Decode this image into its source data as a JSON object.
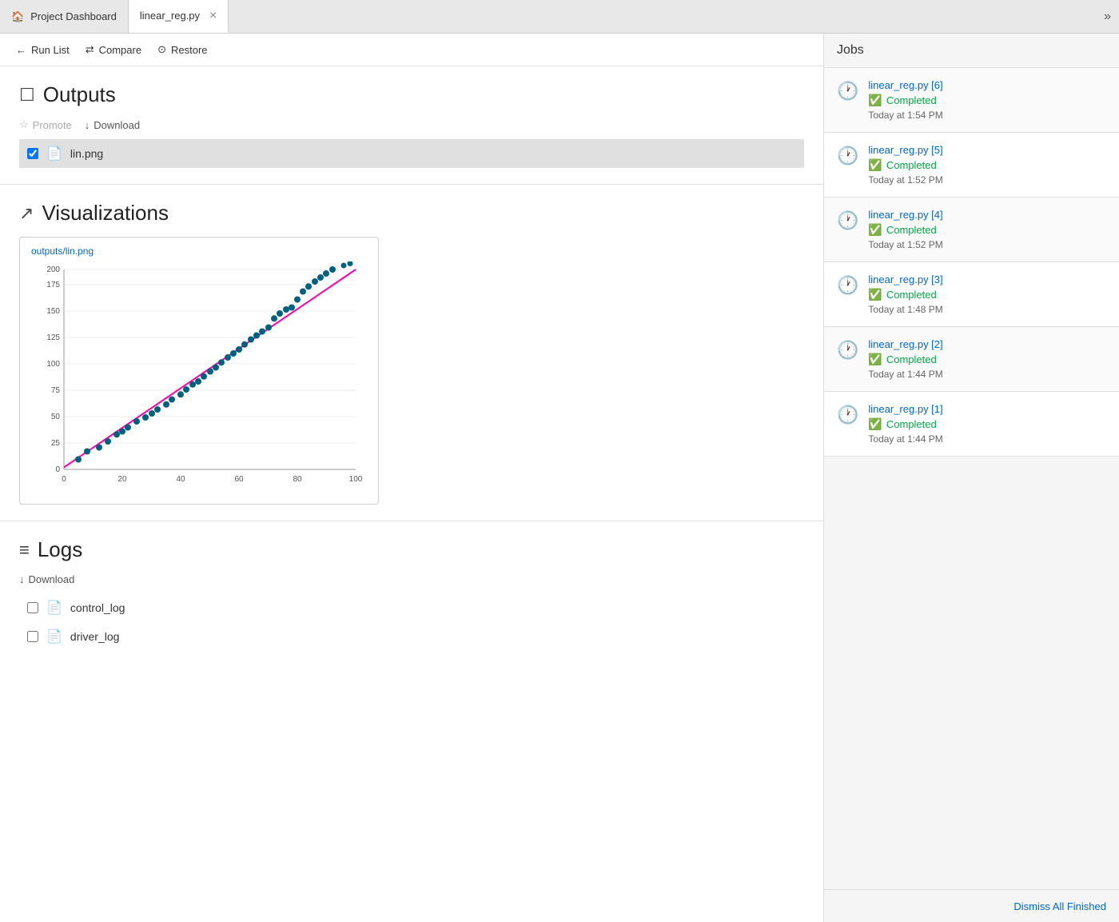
{
  "tabs": [
    {
      "id": "project-dashboard",
      "label": "Project Dashboard",
      "active": false,
      "closable": false,
      "icon": "home"
    },
    {
      "id": "linear-reg",
      "label": "linear_reg.py",
      "active": true,
      "closable": true
    }
  ],
  "toolbar": {
    "run_list_label": "Run List",
    "compare_label": "Compare",
    "restore_label": "Restore"
  },
  "outputs": {
    "section_title": "Outputs",
    "promote_label": "Promote",
    "download_label": "Download",
    "files": [
      {
        "name": "lin.png",
        "selected": true
      }
    ]
  },
  "visualizations": {
    "section_title": "Visualizations",
    "viz_file_label": "outputs/lin.png",
    "chart": {
      "x_min": 0,
      "x_max": 100,
      "y_min": 0,
      "y_max": 200,
      "x_ticks": [
        0,
        20,
        40,
        60,
        80,
        100
      ],
      "y_ticks": [
        0,
        25,
        50,
        75,
        100,
        125,
        150,
        175,
        200
      ],
      "regression_line": {
        "x1": 0,
        "y1": 2,
        "x2": 100,
        "y2": 200
      },
      "points": [
        [
          5,
          10
        ],
        [
          8,
          18
        ],
        [
          12,
          22
        ],
        [
          15,
          28
        ],
        [
          18,
          35
        ],
        [
          20,
          38
        ],
        [
          22,
          42
        ],
        [
          25,
          48
        ],
        [
          28,
          52
        ],
        [
          30,
          56
        ],
        [
          32,
          60
        ],
        [
          35,
          65
        ],
        [
          37,
          70
        ],
        [
          40,
          75
        ],
        [
          42,
          80
        ],
        [
          44,
          85
        ],
        [
          46,
          88
        ],
        [
          48,
          93
        ],
        [
          50,
          98
        ],
        [
          52,
          102
        ],
        [
          54,
          107
        ],
        [
          56,
          112
        ],
        [
          58,
          116
        ],
        [
          60,
          120
        ],
        [
          62,
          125
        ],
        [
          64,
          130
        ],
        [
          66,
          134
        ],
        [
          68,
          138
        ],
        [
          70,
          143
        ],
        [
          72,
          148
        ],
        [
          74,
          152
        ],
        [
          76,
          157
        ],
        [
          78,
          162
        ],
        [
          80,
          166
        ],
        [
          82,
          170
        ],
        [
          84,
          175
        ],
        [
          86,
          180
        ],
        [
          88,
          184
        ],
        [
          90,
          188
        ],
        [
          92,
          192
        ],
        [
          94,
          196
        ],
        [
          96,
          198
        ],
        [
          98,
          200
        ]
      ]
    }
  },
  "logs": {
    "section_title": "Logs",
    "download_label": "Download",
    "files": [
      {
        "name": "control_log",
        "selected": false
      },
      {
        "name": "driver_log",
        "selected": false
      }
    ]
  },
  "jobs_panel": {
    "header": "Jobs",
    "expand_icon": "»",
    "jobs": [
      {
        "id": "job6",
        "name": "linear_reg.py [6]",
        "status": "Completed",
        "time": "Today at 1:54 PM"
      },
      {
        "id": "job5",
        "name": "linear_reg.py [5]",
        "status": "Completed",
        "time": "Today at 1:52 PM"
      },
      {
        "id": "job4",
        "name": "linear_reg.py [4]",
        "status": "Completed",
        "time": "Today at 1:52 PM"
      },
      {
        "id": "job3",
        "name": "linear_reg.py [3]",
        "status": "Completed",
        "time": "Today at 1:48 PM"
      },
      {
        "id": "job2",
        "name": "linear_reg.py [2]",
        "status": "Completed",
        "time": "Today at 1:44 PM"
      },
      {
        "id": "job1",
        "name": "linear_reg.py [1]",
        "status": "Completed",
        "time": "Today at 1:44 PM"
      }
    ],
    "dismiss_label": "Dismiss All Finished"
  }
}
